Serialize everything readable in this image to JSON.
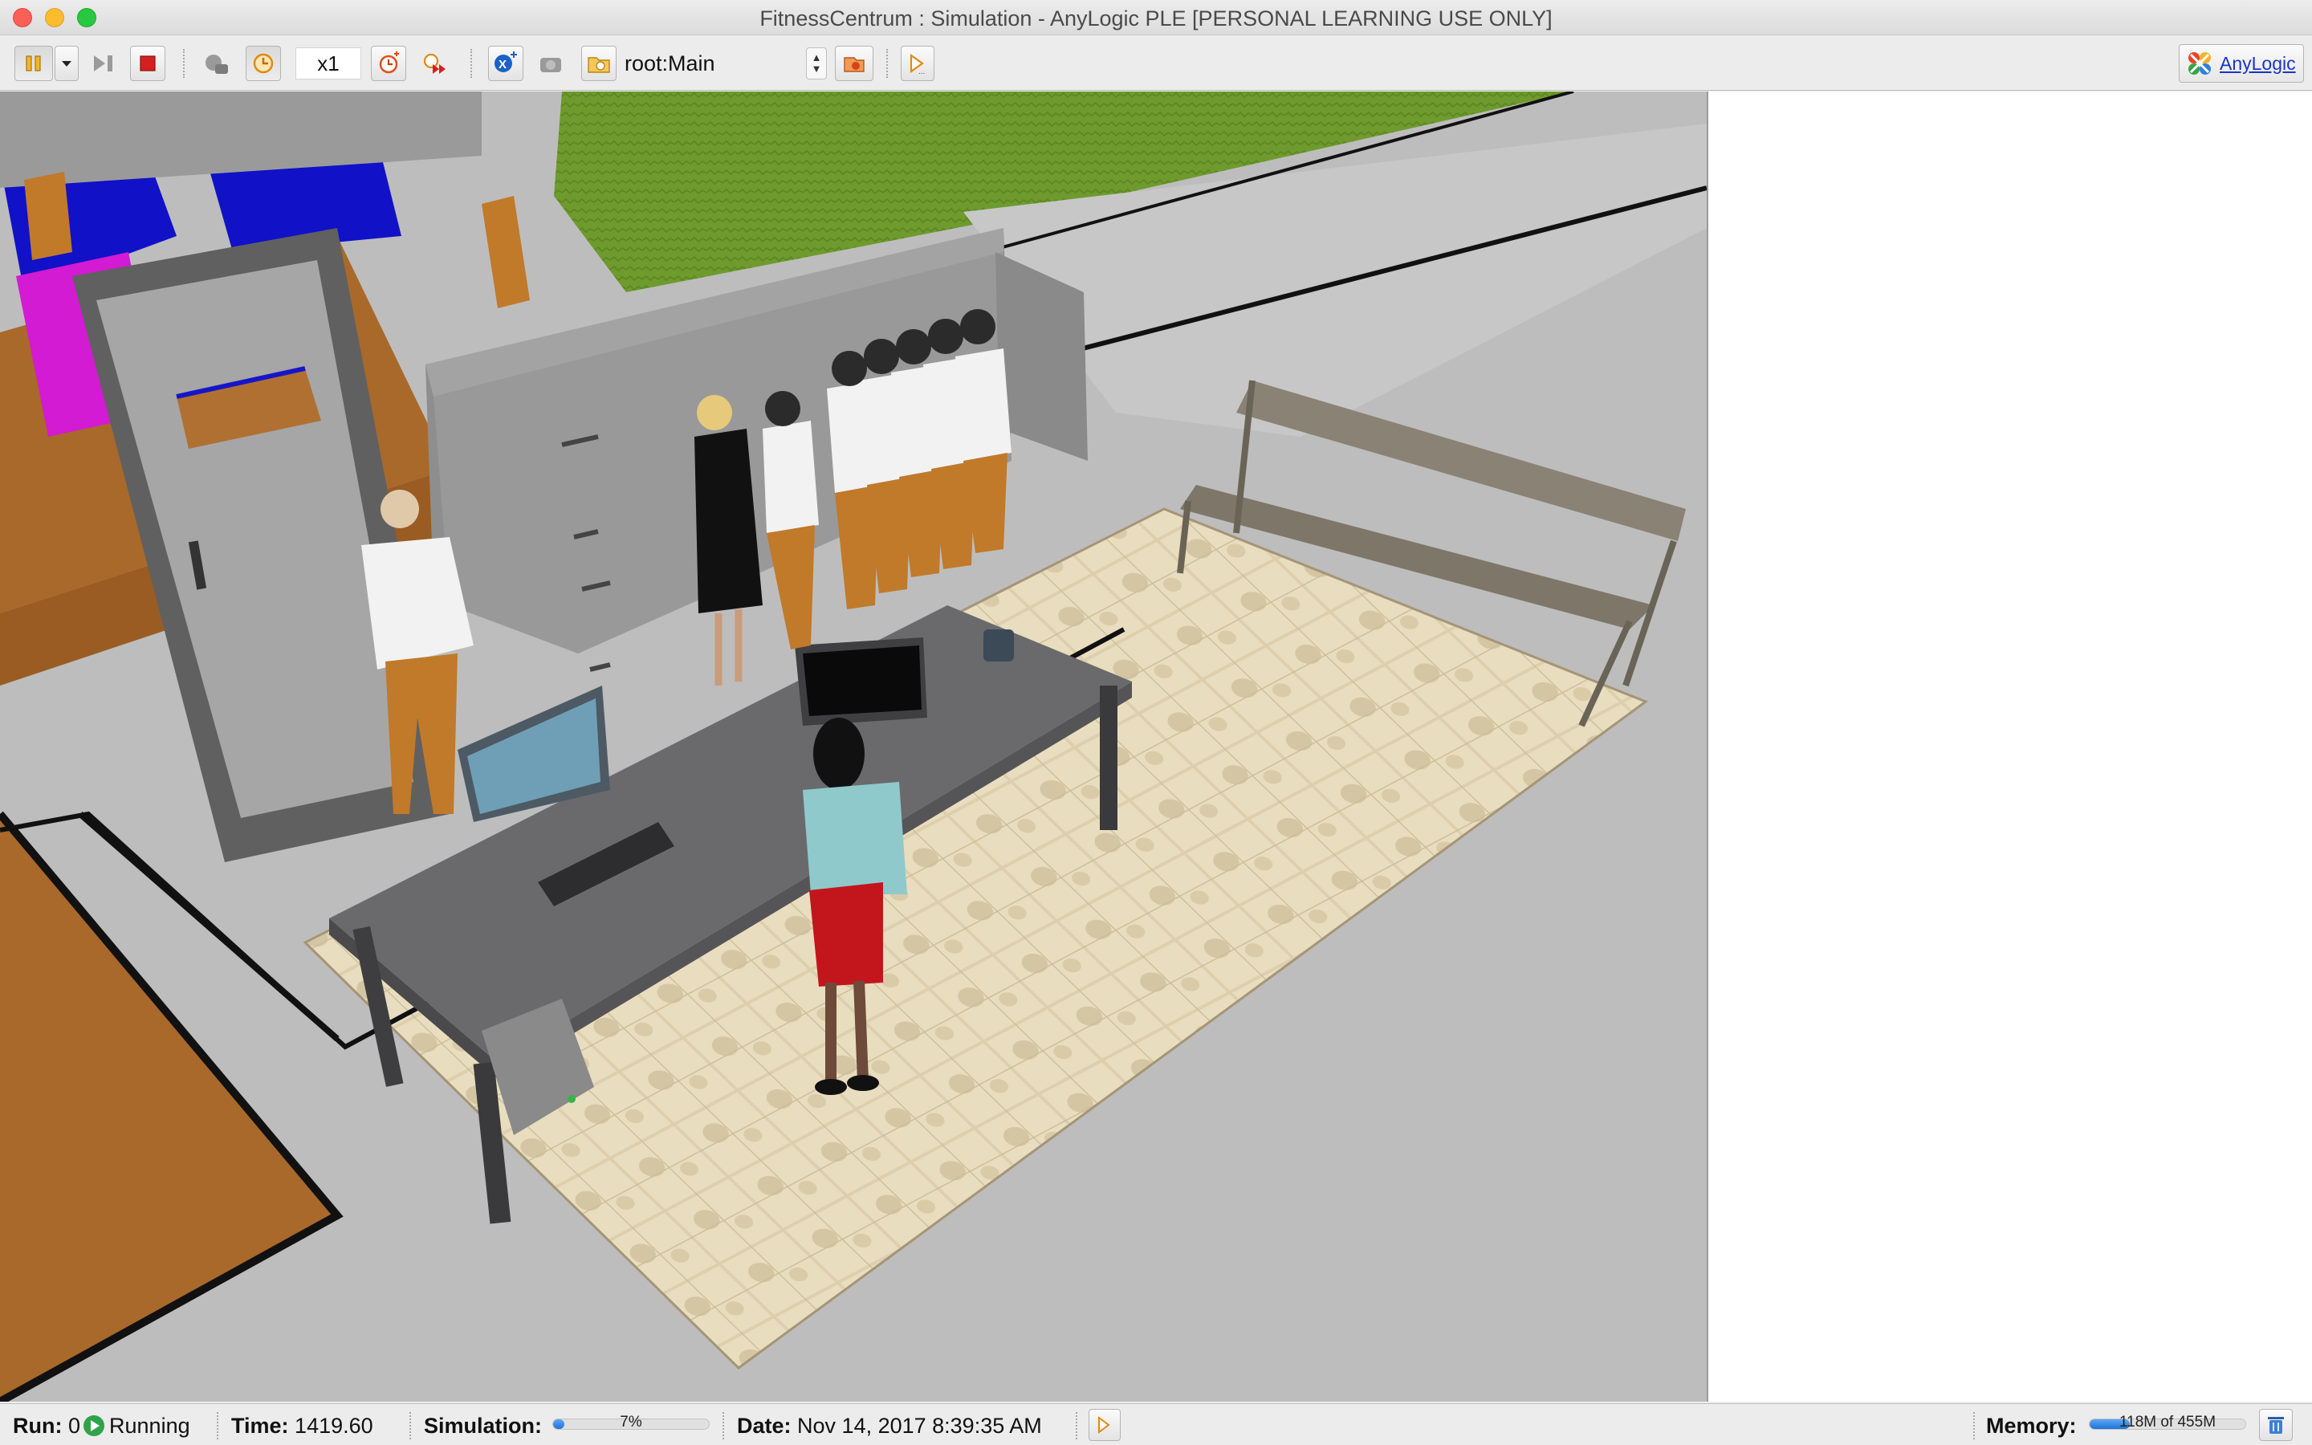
{
  "window": {
    "title": "FitnessCentrum : Simulation - AnyLogic PLE [PERSONAL LEARNING USE ONLY]"
  },
  "toolbar": {
    "speed": "x1",
    "agent_selector": "root:Main",
    "brand_label": "AnyLogic",
    "icons": [
      "pause-icon",
      "dropdown-chevron-icon",
      "step-icon",
      "stop-icon",
      "virtual-time-icon",
      "real-time-icon",
      "speed-up-icon",
      "fast-forward-icon",
      "model-navigate-icon",
      "camera-icon",
      "folder-navigate-icon",
      "view-area-icon",
      "experiment-run-icon"
    ]
  },
  "status": {
    "run_label": "Run:",
    "run_value": "0",
    "state": "Running",
    "time_label": "Time:",
    "time_value": "1419.60",
    "simulation_label": "Simulation:",
    "simulation_progress": "7%",
    "simulation_fraction": 0.07,
    "date_label": "Date:",
    "date_value": "Nov 14, 2017 8:39:35 AM",
    "memory_label": "Memory:",
    "memory_value": "118M of 455M",
    "memory_fraction": 0.26
  },
  "colors": {
    "accent": "#1f74d8",
    "stop": "#d62020",
    "run": "#2fa34a",
    "brand": "#1a35c8"
  }
}
